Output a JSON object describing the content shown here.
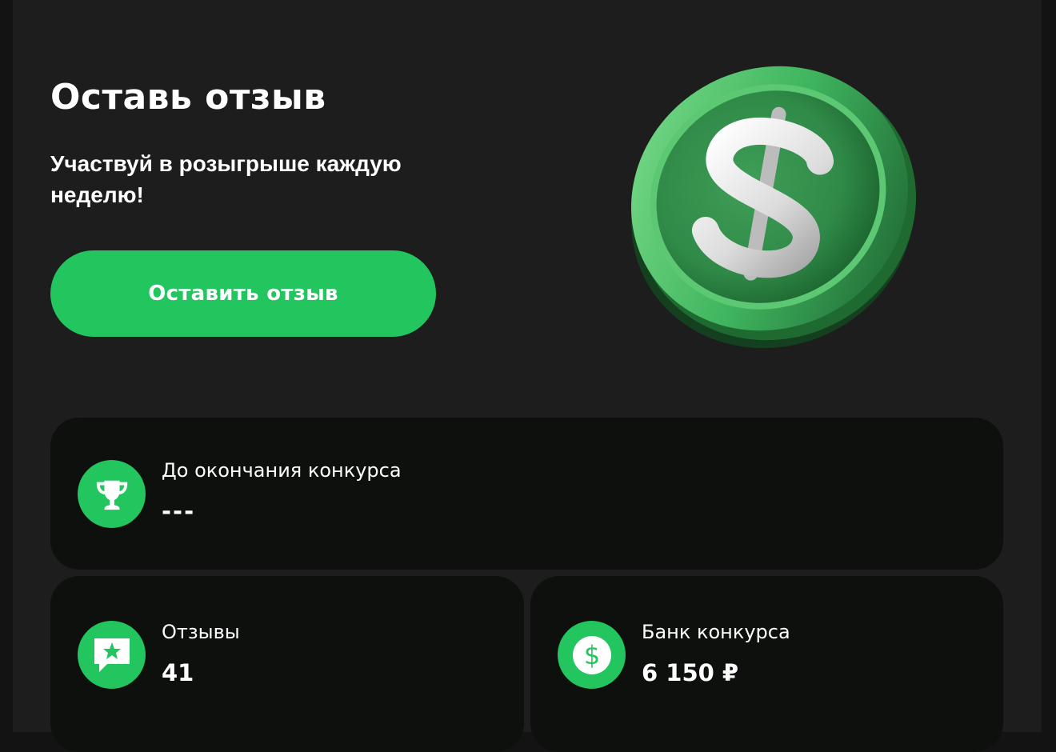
{
  "hero": {
    "title": "Оставь отзыв",
    "subtitle": "Участвуй в розыгрыше каждую неделю!",
    "cta_label": "Оставить отзыв",
    "coin_icon": "dollar-coin-illustration"
  },
  "stats": {
    "timer": {
      "icon": "trophy-icon",
      "label": "До окончания конкурса",
      "value": "---"
    },
    "reviews": {
      "icon": "review-star-icon",
      "label": "Отзывы",
      "value": "41"
    },
    "bank": {
      "icon": "dollar-icon",
      "label": "Банк конкурса",
      "value": "6 150 ₽"
    }
  },
  "colors": {
    "page_background": "#1c1d1c",
    "card_background": "#0e100e",
    "accent": "#22c55e",
    "text": "#ffffff"
  }
}
